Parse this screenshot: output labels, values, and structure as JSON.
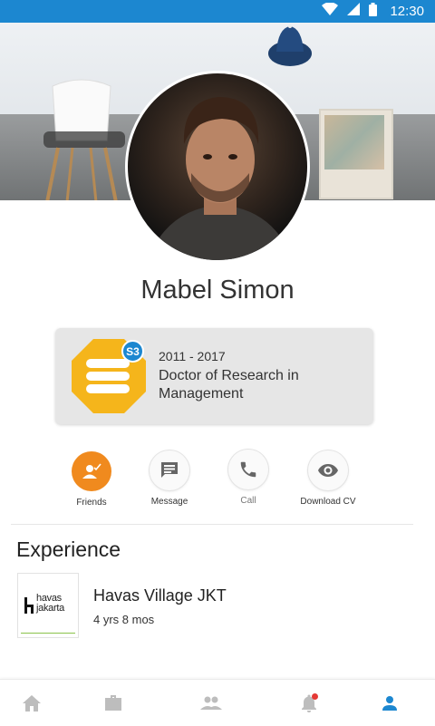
{
  "status_bar": {
    "time": "12:30",
    "icons": [
      "wifi-icon",
      "signal-icon",
      "battery-icon"
    ],
    "color": "#1c87d0"
  },
  "profile": {
    "name": "Mabel Simon",
    "cover_image": "room-with-chair-hat-and-map",
    "avatar_image": "man-portrait"
  },
  "education": {
    "badge_icon": "education-badge-icon",
    "level": "S3",
    "years": "2011 - 2017",
    "degree": "Doctor of Research in Management"
  },
  "actions": [
    {
      "label": "Friends",
      "icon": "add-friend-icon",
      "active": true
    },
    {
      "label": "Message",
      "icon": "message-icon"
    },
    {
      "label": "Call",
      "icon": "phone-icon"
    },
    {
      "label": "Download CV",
      "icon": "eye-icon"
    }
  ],
  "experience": {
    "title": "Experience",
    "items": [
      {
        "company": "Havas Village JKT",
        "duration": "4 yrs 8 mos",
        "logo_text": [
          "havas",
          "jakarta"
        ]
      }
    ]
  },
  "bottom_nav": [
    {
      "icon": "home-icon"
    },
    {
      "icon": "briefcase-icon"
    },
    {
      "icon": "people-icon"
    },
    {
      "icon": "bell-icon",
      "badge": true
    },
    {
      "icon": "profile-icon",
      "active": true
    }
  ],
  "colors": {
    "accent": "#1c87d0",
    "orange": "#f08a1e",
    "badge_yellow": "#f5b51b",
    "notification": "#e53935"
  }
}
